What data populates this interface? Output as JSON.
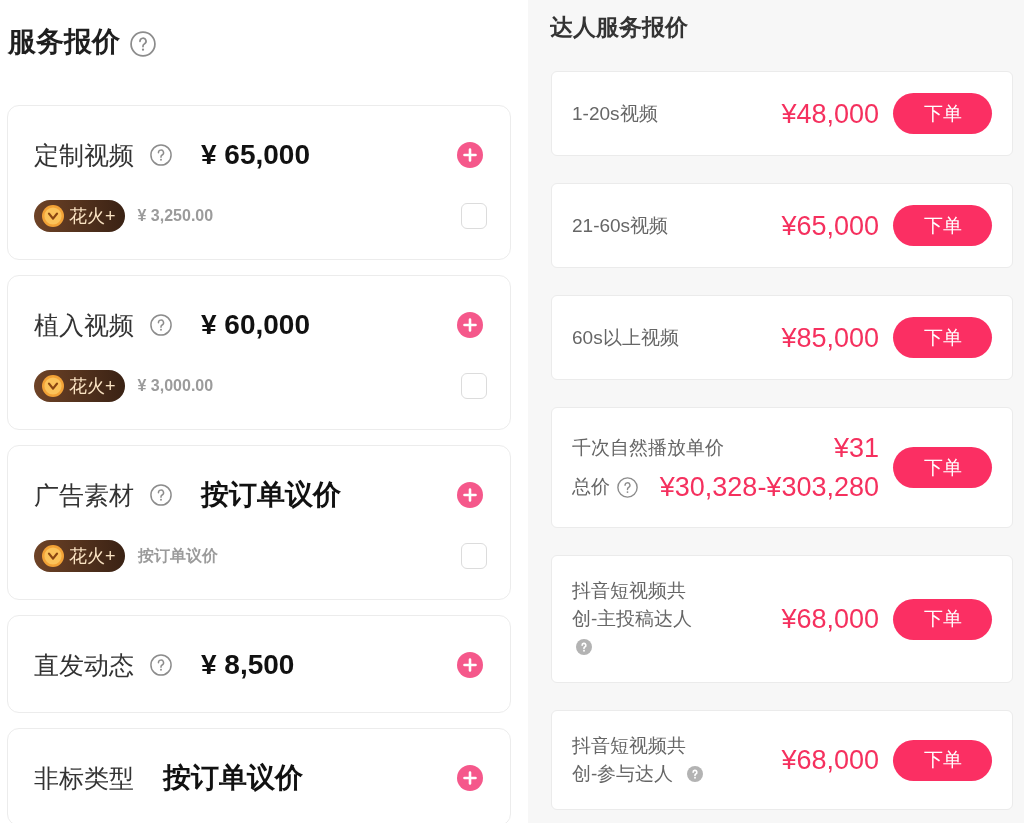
{
  "service_quote": {
    "title": "服务报价",
    "help": true,
    "items": [
      {
        "label": "定制视频",
        "help": true,
        "price": "¥ 65,000",
        "spark": {
          "badge": "花火+",
          "price": "¥ 3,250.00",
          "checked": false
        }
      },
      {
        "label": "植入视频",
        "help": true,
        "price": "¥ 60,000",
        "spark": {
          "badge": "花火+",
          "price": "¥ 3,000.00",
          "checked": false
        }
      },
      {
        "label": "广告素材",
        "help": true,
        "price": "按订单议价",
        "spark": {
          "badge": "花火+",
          "price": "按订单议价",
          "checked": false
        }
      },
      {
        "label": "直发动态",
        "help": true,
        "price": "¥ 8,500"
      },
      {
        "label": "非标类型",
        "help": false,
        "price": "按订单议价"
      }
    ]
  },
  "talent_quote": {
    "title": "达人服务报价",
    "items": [
      {
        "kind": "fixed",
        "label": "1-20s视频",
        "help": false,
        "price": "¥48,000",
        "button": "下单"
      },
      {
        "kind": "fixed",
        "label": "21-60s视频",
        "help": false,
        "price": "¥65,000",
        "button": "下单"
      },
      {
        "kind": "fixed",
        "label": "60s以上视频",
        "help": false,
        "price": "¥85,000",
        "button": "下单"
      },
      {
        "kind": "cpm",
        "label": "千次自然播放单价",
        "price": "¥31",
        "total_label": "总价",
        "help": true,
        "total_price": "¥30,328-¥303,280",
        "button": "下单"
      },
      {
        "kind": "fixed",
        "label": "抖音短视频共创-主投稿达人",
        "help": true,
        "price": "¥68,000",
        "button": "下单"
      },
      {
        "kind": "fixed",
        "label": "抖音短视频共创-参与达人",
        "help": true,
        "price": "¥68,000",
        "button": "下单"
      }
    ]
  }
}
